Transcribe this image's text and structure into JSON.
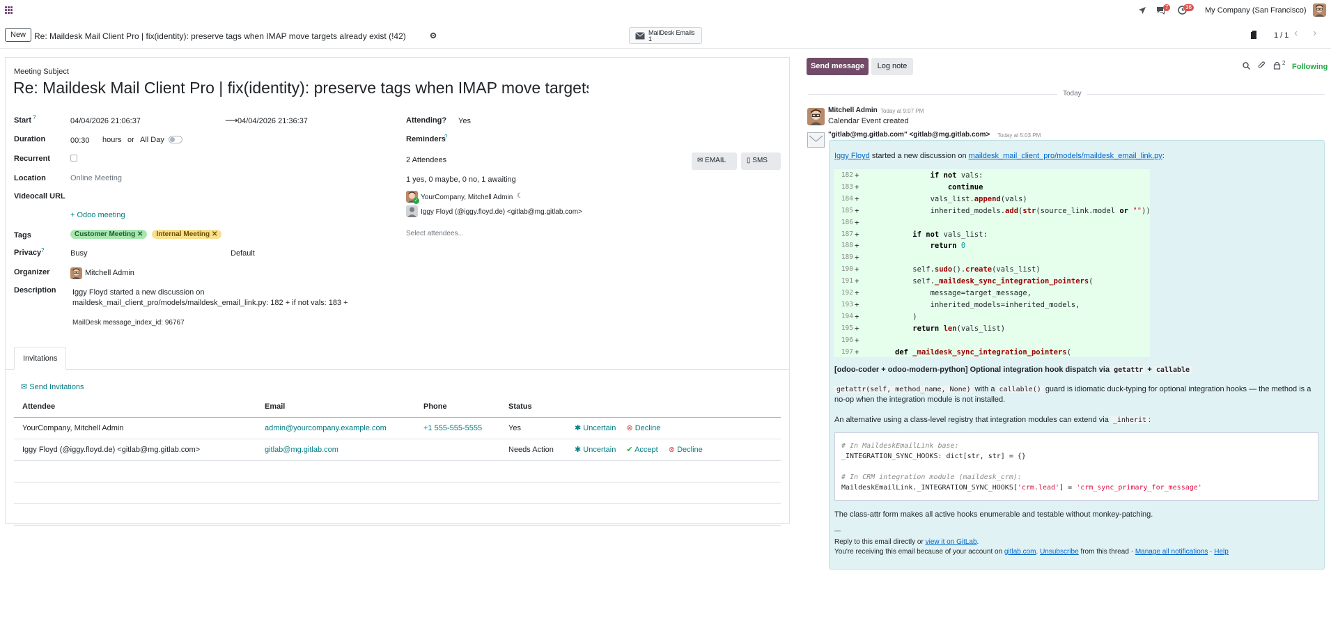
{
  "topnav": {
    "badge_chat": "7",
    "badge_activity": "36",
    "company": "My Company (San Francisco)"
  },
  "control": {
    "new_label": "New",
    "breadcrumb_title": "Re: Maildesk Mail Client Pro | fix(identity): preserve tags when IMAP move targets already exist (!42)",
    "smart_button_label": "MailDesk Emails",
    "smart_button_count": "1",
    "pager": "1 / 1"
  },
  "form": {
    "subject_label": "Meeting Subject",
    "subject": "Re: Maildesk Mail Client Pro | fix(identity): preserve tags when IMAP move targets already exist (!42)",
    "start_label": "Start",
    "start": "04/04/2026 21:06:37",
    "stop": "04/04/2026 21:36:37",
    "duration_label": "Duration",
    "duration": "00:30",
    "hours": "hours",
    "or": "or",
    "allday": "All Day",
    "recurrent_label": "Recurrent",
    "location_label": "Location",
    "location": "Online Meeting",
    "videocall_label": "Videocall URL",
    "odoo_meeting": "Odoo meeting",
    "tags_label": "Tags",
    "tags": [
      "Customer Meeting",
      "Internal Meeting"
    ],
    "privacy_label": "Privacy",
    "privacy": "Busy",
    "show_as": "Default",
    "organizer_label": "Organizer",
    "organizer": "Mitchell Admin",
    "description_label": "Description",
    "description_1": "Iggy Floyd started a new discussion on",
    "description_2": "maildesk_mail_client_pro/models/maildesk_email_link.py: 182 + if not vals: 183 +",
    "description_3": "MailDesk message_index_id: 96767",
    "attending_label": "Attending?",
    "attending": "Yes",
    "reminders_label": "Reminders",
    "attendees_count": "2 Attendees",
    "email_btn": "EMAIL",
    "sms_btn": "SMS",
    "attendees_summary": "1 yes, 0 maybe, 0 no, 1 awaiting",
    "attendee_1": "YourCompany, Mitchell Admin",
    "attendee_2": "Iggy Floyd (@iggy.floyd.de) <gitlab@mg.gitlab.com>",
    "select_attendees": "Select attendees...",
    "tab_invitations": "Invitations",
    "send_invitations": "Send Invitations",
    "table_headers": [
      "Attendee",
      "Email",
      "Phone",
      "Status"
    ],
    "rows": [
      {
        "attendee": "YourCompany, Mitchell Admin",
        "email": "admin@yourcompany.example.com",
        "phone": "+1 555-555-5555",
        "status": "Yes",
        "a1": "Uncertain",
        "a2": "Decline"
      },
      {
        "attendee": "Iggy Floyd (@iggy.floyd.de) <gitlab@mg.gitlab.com>",
        "email": "gitlab@mg.gitlab.com",
        "phone": "",
        "status": "Needs Action",
        "a1": "Uncertain",
        "a2": "Accept",
        "a3": "Decline"
      }
    ]
  },
  "chatter": {
    "send_message": "Send message",
    "log_note": "Log note",
    "followers_count": "2",
    "following": "Following",
    "today": "Today",
    "msg1_author": "Mitchell Admin",
    "msg1_time": "Today at 9:07 PM",
    "msg1_body": "Calendar Event created",
    "msg2_author": "\"gitlab@mg.gitlab.com\" <gitlab@mg.gitlab.com>",
    "msg2_time": "Today at 5:03 PM",
    "intro_author": "Iggy Floyd",
    "intro_text": "started a new discussion on",
    "intro_path": "maildesk_mail_client_pro/models/maildesk_email_link.py",
    "code_lines": [
      {
        "n": "182",
        "t": "        if not vals:"
      },
      {
        "n": "183",
        "t": "            continue"
      },
      {
        "n": "184",
        "t": "        vals_list.append(vals)"
      },
      {
        "n": "185",
        "t": "        inherited_models.add(str(source_link.model or \"\"))"
      },
      {
        "n": "186",
        "t": ""
      },
      {
        "n": "187",
        "t": "    if not vals_list:"
      },
      {
        "n": "188",
        "t": "        return 0"
      },
      {
        "n": "189",
        "t": ""
      },
      {
        "n": "190",
        "t": "    self.sudo().create(vals_list)"
      },
      {
        "n": "191",
        "t": "    self._maildesk_sync_integration_pointers("
      },
      {
        "n": "192",
        "t": "        message=target_message,"
      },
      {
        "n": "193",
        "t": "        inherited_models=inherited_models,"
      },
      {
        "n": "194",
        "t": "    )"
      },
      {
        "n": "195",
        "t": "    return len(vals_list)"
      },
      {
        "n": "196",
        "t": ""
      },
      {
        "n": "197",
        "t": "def _maildesk_sync_integration_pointers("
      }
    ],
    "heading": "[odoo-coder + odoo-modern-python] Optional integration hook dispatch via",
    "heading_code1": "getattr",
    "heading_plus": "+",
    "heading_code2": "callable",
    "p1_code1": "getattr(self, method_name, None)",
    "p1_a": "with a",
    "p1_code2": "callable()",
    "p1_b": "guard is idiomatic duck-typing for optional integration hooks — the method is a no-op when the integration module is not installed.",
    "p2": "An alternative using a class-level registry that integration modules can extend via",
    "p2_code": "_inherit",
    "p2_end": ":",
    "cb_c1": "# In MaildeskEmailLink base:",
    "cb_l1": "_INTEGRATION_SYNC_HOOKS: dict[str, str] = {}",
    "cb_c2": "# In CRM integration module (maildesk_crm):",
    "cb_l2a": "MaildeskEmailLink._INTEGRATION_SYNC_HOOKS[",
    "cb_l2b": "'crm.lead'",
    "cb_l2c": "] = ",
    "cb_l2d": "'crm_sync_primary_for_message'",
    "p3": "The class-attr form makes all active hooks enumerable and testable without monkey-patching.",
    "sep": "—",
    "reply_a": "Reply to this email directly or",
    "reply_link": "view it on GitLab",
    "reply_b": ".",
    "recv_a": "You're receiving this email because of your account on",
    "recv_link1": "gitlab.com",
    "recv_dot": ".",
    "recv_link2": "Unsubscribe",
    "recv_b": "from this thread ·",
    "recv_link3": "Manage all notifications",
    "recv_c": "·",
    "recv_link4": "Help"
  }
}
